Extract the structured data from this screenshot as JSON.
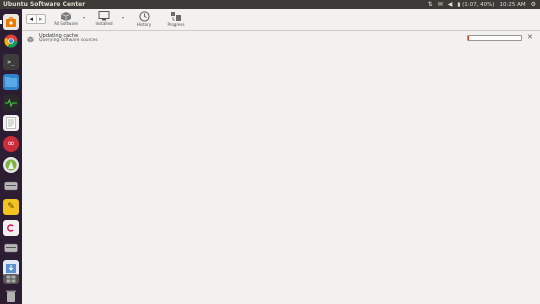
{
  "window": {
    "title": "Ubuntu Software Center"
  },
  "tray": {
    "network_icon": "network-icon",
    "keyboard_icon": "keyboard-icon",
    "sound_icon": "volume-icon",
    "battery_text": "(1:07, 40%)",
    "clock": "10:25 AM",
    "settings_icon": "gear-icon"
  },
  "launcher": {
    "items": [
      {
        "name": "ubuntu-software-center-icon",
        "color": "#ea7b00"
      },
      {
        "name": "chromium-browser-icon",
        "color": "#3a7bd5"
      },
      {
        "name": "terminal-icon",
        "color": "#444444"
      },
      {
        "name": "files-icon",
        "color": "#2f83c8"
      },
      {
        "name": "system-monitor-icon",
        "color": "#333333"
      },
      {
        "name": "text-editor-icon",
        "color": "#d8d8d8"
      },
      {
        "name": "infinity-app-icon",
        "color": "#cc2d3a"
      },
      {
        "name": "android-studio-icon",
        "color": "#7cb342"
      },
      {
        "name": "disk-drive-icon",
        "color": "#8a8a8a"
      },
      {
        "name": "pencil-app-icon",
        "color": "#f2c420"
      },
      {
        "name": "debian-package-icon",
        "color": "#e8e8e8"
      },
      {
        "name": "disk-drive-2-icon",
        "color": "#8a8a8a"
      },
      {
        "name": "software-updater-icon",
        "color": "#5a8fd0"
      },
      {
        "name": "workspace-switcher-icon",
        "color": "#555555"
      },
      {
        "name": "trash-icon",
        "color": "#9a9a9a"
      }
    ]
  },
  "toolbar": {
    "all_software": "All Software",
    "installed": "Installed",
    "history": "History",
    "progress": "Progress"
  },
  "status": {
    "title": "Updating cache",
    "subtitle": "Querying software sources",
    "progress": 0.02
  }
}
